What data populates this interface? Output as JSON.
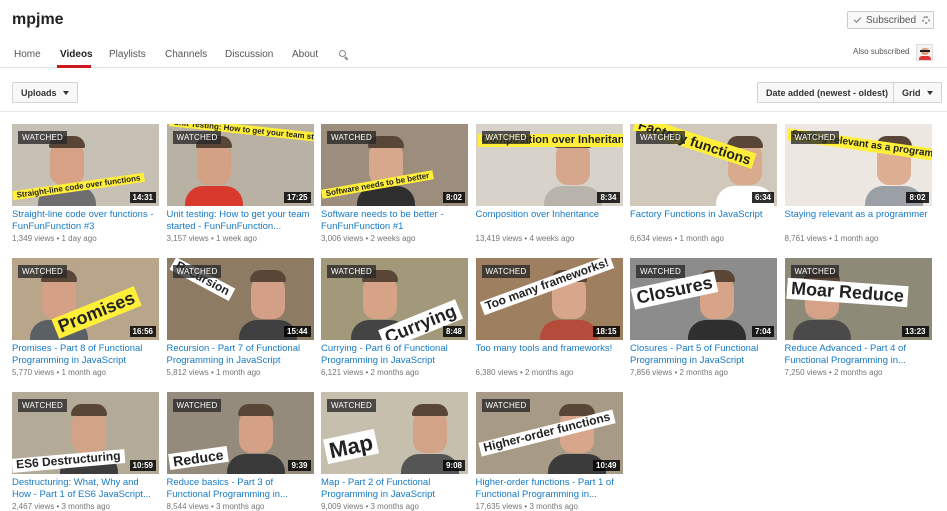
{
  "channel": {
    "name": "mpjme",
    "subscribe_label": "Subscribed",
    "also_subscribed": "Also subscribed"
  },
  "tabs": [
    {
      "label": "Home"
    },
    {
      "label": "Videos"
    },
    {
      "label": "Playlists"
    },
    {
      "label": "Channels"
    },
    {
      "label": "Discussion"
    },
    {
      "label": "About"
    }
  ],
  "active_tab": "Videos",
  "icons": {
    "search": "search-icon",
    "gear": "gear-icon",
    "check": "checkmark-icon",
    "avatar": "avatar-icon"
  },
  "toolbar": {
    "uploads_label": "Uploads",
    "sort_label": "Date added (newest - oldest)",
    "view_label": "Grid"
  },
  "colors": {
    "link": "#167ac6",
    "accent": "#cc181e",
    "banner_yellow": "#ffef3a"
  },
  "videos": [
    {
      "title": "Straight-line code over functions - FunFunFunction #3",
      "views": "1,349 views",
      "age": "1 day ago",
      "duration": "14:31",
      "watched": "WATCHED",
      "overlay": "Straight-line code over functions"
    },
    {
      "title": "Unit testing: How to get your team started - FunFunFunction...",
      "views": "3,157 views",
      "age": "1 week ago",
      "duration": "17:25",
      "watched": "WATCHED",
      "overlay": "Unit Testing: How to get your team started"
    },
    {
      "title": "Software needs to be better - FunFunFunction #1",
      "views": "3,006 views",
      "age": "2 weeks ago",
      "duration": "8:02",
      "watched": "WATCHED",
      "overlay": "Software needs to be better"
    },
    {
      "title": "Composition over Inheritance",
      "views": "13,419 views",
      "age": "4 weeks ago",
      "duration": "8:34",
      "watched": "WATCHED",
      "overlay": "Composition over Inheritance"
    },
    {
      "title": "Factory Functions in JavaScript",
      "views": "6,634 views",
      "age": "1 month ago",
      "duration": "6:34",
      "watched": "WATCHED",
      "overlay": "Factory functions"
    },
    {
      "title": "Staying relevant as a programmer",
      "views": "8,761 views",
      "age": "1 month ago",
      "duration": "8:02",
      "watched": "WATCHED",
      "overlay": "Staying relevant as a programmer"
    },
    {
      "title": "Promises - Part 8 of Functional Programming in JavaScript",
      "views": "5,770 views",
      "age": "1 month ago",
      "duration": "16:56",
      "watched": "WATCHED",
      "overlay": "Promises"
    },
    {
      "title": "Recursion - Part 7 of Functional Programming in JavaScript",
      "views": "5,812 views",
      "age": "1 month ago",
      "duration": "15:44",
      "watched": "WATCHED",
      "overlay": "Recursion"
    },
    {
      "title": "Currying - Part 6 of Functional Programming in JavaScript",
      "views": "6,121 views",
      "age": "2 months ago",
      "duration": "8:48",
      "watched": "WATCHED",
      "overlay": "Currying"
    },
    {
      "title": "Too many tools and frameworks!",
      "views": "6,380 views",
      "age": "2 months ago",
      "duration": "18:15",
      "watched": "WATCHED",
      "overlay": "Too many frameworks!"
    },
    {
      "title": "Closures - Part 5 of Functional Programming in JavaScript",
      "views": "7,856 views",
      "age": "2 months ago",
      "duration": "7:04",
      "watched": "WATCHED",
      "overlay": "Closures"
    },
    {
      "title": "Reduce Advanced - Part 4 of Functional Programming in...",
      "views": "7,250 views",
      "age": "2 months ago",
      "duration": "13:23",
      "watched": "WATCHED",
      "overlay": "Moar Reduce"
    },
    {
      "title": "Destructuring: What, Why and How - Part 1 of ES6 JavaScript...",
      "views": "2,467 views",
      "age": "3 months ago",
      "duration": "10:59",
      "watched": "WATCHED",
      "overlay": "ES6 Destructuring"
    },
    {
      "title": "Reduce basics - Part 3 of Functional Programming in...",
      "views": "8,544 views",
      "age": "3 months ago",
      "duration": "9:39",
      "watched": "WATCHED",
      "overlay": "Reduce"
    },
    {
      "title": "Map - Part 2 of Functional Programming in JavaScript",
      "views": "9,009 views",
      "age": "3 months ago",
      "duration": "9:08",
      "watched": "WATCHED",
      "overlay": "Map"
    },
    {
      "title": "Higher-order functions - Part 1 of Functional Programming in...",
      "views": "17,635 views",
      "age": "3 months ago",
      "duration": "10:49",
      "watched": "WATCHED",
      "overlay": "Higher-order functions"
    }
  ]
}
